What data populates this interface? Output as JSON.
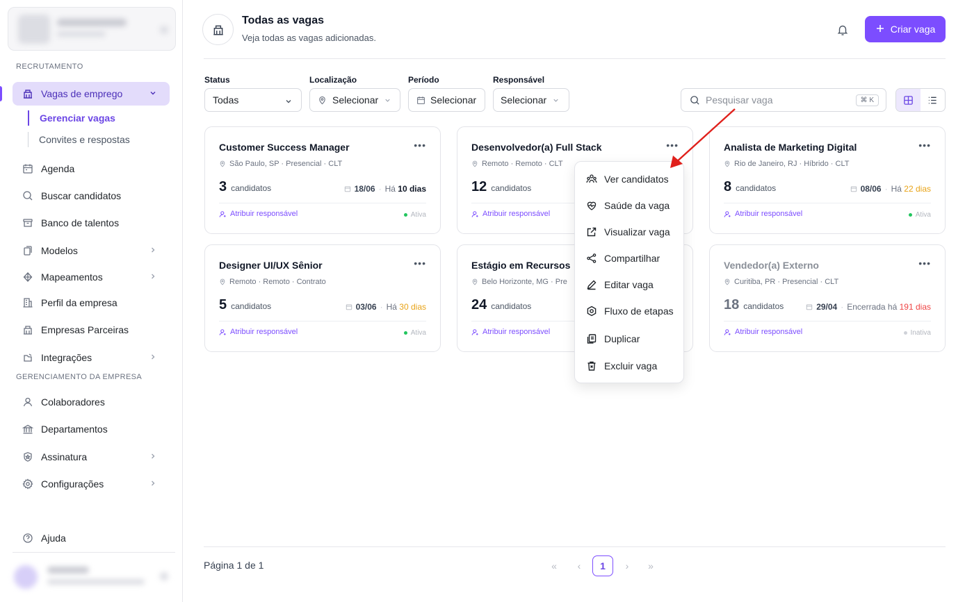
{
  "sidebar": {
    "sections": {
      "recruitment": "RECRUTAMENTO",
      "company": "GERENCIAMENTO DA EMPRESA"
    },
    "items": [
      {
        "label": "Vagas de emprego"
      },
      {
        "label": "Agenda"
      },
      {
        "label": "Buscar candidatos"
      },
      {
        "label": "Banco de talentos"
      },
      {
        "label": "Modelos"
      },
      {
        "label": "Mapeamentos"
      },
      {
        "label": "Perfil da empresa"
      },
      {
        "label": "Empresas Parceiras"
      },
      {
        "label": "Integrações"
      },
      {
        "label": "Colaboradores"
      },
      {
        "label": "Departamentos"
      },
      {
        "label": "Assinatura"
      },
      {
        "label": "Configurações"
      },
      {
        "label": "Ajuda"
      }
    ],
    "subitems": [
      {
        "label": "Gerenciar vagas"
      },
      {
        "label": "Convites e respostas"
      }
    ]
  },
  "header": {
    "title": "Todas as vagas",
    "subtitle": "Veja todas as vagas adicionadas.",
    "create_label": "Criar vaga"
  },
  "filters": {
    "status_label": "Status",
    "status_value": "Todas",
    "location_label": "Localização",
    "location_value": "Selecionar",
    "period_label": "Período",
    "period_value": "Selecionar",
    "owner_label": "Responsável",
    "owner_value": "Selecionar",
    "search_placeholder": "Pesquisar vaga",
    "search_shortcut": "⌘ K"
  },
  "jobs": [
    {
      "title": "Customer Success Manager",
      "meta": "São Paulo, SP · Presencial · CLT",
      "count": "3",
      "count_label": "candidatos",
      "date": "18/06",
      "days_prefix": "Há",
      "days": "10 dias",
      "assign": "Atribuir responsável",
      "status": "Ativa"
    },
    {
      "title": "Desenvolvedor(a) Full Stack",
      "meta": "Remoto · Remoto · CLT",
      "count": "12",
      "count_label": "candidatos",
      "assign": "Atribuir responsável"
    },
    {
      "title": "Analista de Marketing Digital",
      "meta": "Rio de Janeiro, RJ · Híbrido · CLT",
      "count": "8",
      "count_label": "candidatos",
      "date": "08/06",
      "days_prefix": "Há",
      "days": "22 dias",
      "assign": "Atribuir responsável",
      "status": "Ativa"
    },
    {
      "title": "Designer UI/UX Sênior",
      "meta": "Remoto · Remoto · Contrato",
      "count": "5",
      "count_label": "candidatos",
      "date": "03/06",
      "days_prefix": "Há",
      "days": "30 dias",
      "assign": "Atribuir responsável",
      "status": "Ativa"
    },
    {
      "title": "Estágio em Recursos",
      "meta": "Belo Horizonte, MG · Pre",
      "count": "24",
      "count_label": "candidatos",
      "assign": "Atribuir responsável"
    },
    {
      "title": "Vendedor(a) Externo",
      "meta": "Curitiba, PR · Presencial · CLT",
      "count": "18",
      "count_label": "candidatos",
      "date": "29/04",
      "days_prefix": "Encerrada há",
      "days": "191 dias",
      "assign": "Atribuir responsável",
      "status": "Inativa"
    }
  ],
  "menu": {
    "items": [
      {
        "label": "Ver candidatos"
      },
      {
        "label": "Saúde da vaga"
      },
      {
        "label": "Visualizar vaga"
      },
      {
        "label": "Compartilhar"
      },
      {
        "label": "Editar vaga"
      },
      {
        "label": "Fluxo de etapas"
      },
      {
        "label": "Duplicar"
      },
      {
        "label": "Excluir vaga"
      }
    ]
  },
  "pagination": {
    "info": "Página 1 de 1",
    "current": "1",
    "first": "«",
    "prev": "‹",
    "next": "›",
    "last": "»"
  },
  "colors": {
    "accent": "#7c4dff",
    "active_nav_bg": "#e3dcfb",
    "status_active": "#22c55e",
    "warn": "#e8a317",
    "danger": "#ef4444",
    "annotation_arrow": "#e0201b"
  }
}
